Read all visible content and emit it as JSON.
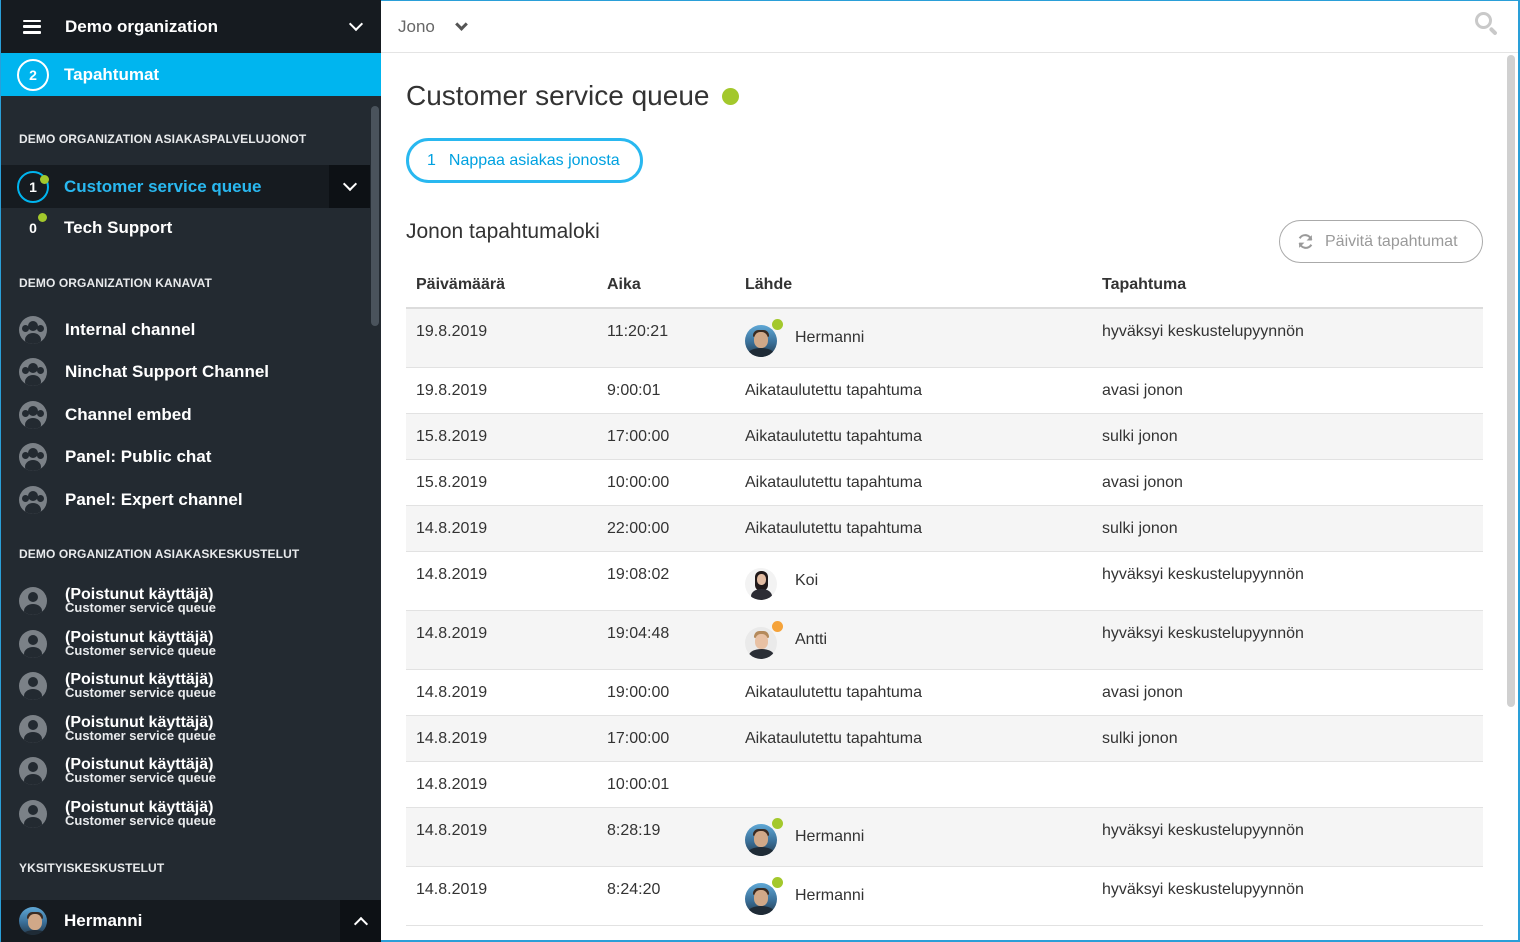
{
  "sidebar": {
    "org_name": "Demo organization",
    "events": {
      "count": "2",
      "label": "Tapahtumat"
    },
    "queues_heading": "DEMO ORGANIZATION ASIAKASPALVELUJONOT",
    "queues": [
      {
        "count": "1",
        "label": "Customer service queue",
        "active": true
      },
      {
        "count": "0",
        "label": "Tech Support",
        "active": false
      }
    ],
    "channels_heading": "DEMO ORGANIZATION KANAVAT",
    "channels": [
      {
        "label": "Internal channel"
      },
      {
        "label": "Ninchat Support Channel"
      },
      {
        "label": "Channel embed"
      },
      {
        "label": "Panel: Public chat"
      },
      {
        "label": "Panel: Expert channel"
      }
    ],
    "conversations_heading": "DEMO ORGANIZATION ASIAKASKESKUSTELUT",
    "conversations": [
      {
        "name": "(Poistunut käyttäjä)",
        "sub": "Customer service queue"
      },
      {
        "name": "(Poistunut käyttäjä)",
        "sub": "Customer service queue"
      },
      {
        "name": "(Poistunut käyttäjä)",
        "sub": "Customer service queue"
      },
      {
        "name": "(Poistunut käyttäjä)",
        "sub": "Customer service queue"
      },
      {
        "name": "(Poistunut käyttäjä)",
        "sub": "Customer service queue"
      },
      {
        "name": "(Poistunut käyttäjä)",
        "sub": "Customer service queue"
      }
    ],
    "private_heading": "YKSITYISKESKUSTELUT",
    "private_user": "Hermanni"
  },
  "topbar": {
    "breadcrumb": "Jono"
  },
  "main": {
    "title": "Customer service queue",
    "pick_button": {
      "count": "1",
      "label": "Nappaa asiakas jonosta"
    },
    "log_title": "Jonon tapahtumaloki",
    "refresh_label": "Päivitä tapahtumat",
    "columns": [
      "Päivämäärä",
      "Aika",
      "Lähde",
      "Tapahtuma"
    ],
    "rows": [
      {
        "date": "19.8.2019",
        "time": "11:20:21",
        "source": "Hermanni",
        "avatar": "herm",
        "status": "#a3c82c",
        "event": "hyväksyi keskustelupyynnön"
      },
      {
        "date": "19.8.2019",
        "time": "9:00:01",
        "source": "Aikataulutettu tapahtuma",
        "event": "avasi jonon"
      },
      {
        "date": "15.8.2019",
        "time": "17:00:00",
        "source": "Aikataulutettu tapahtuma",
        "event": "sulki jonon"
      },
      {
        "date": "15.8.2019",
        "time": "10:00:00",
        "source": "Aikataulutettu tapahtuma",
        "event": "avasi jonon"
      },
      {
        "date": "14.8.2019",
        "time": "22:00:00",
        "source": "Aikataulutettu tapahtuma",
        "event": "sulki jonon"
      },
      {
        "date": "14.8.2019",
        "time": "19:08:02",
        "source": "Koi",
        "avatar": "koi",
        "event": "hyväksyi keskustelupyynnön"
      },
      {
        "date": "14.8.2019",
        "time": "19:04:48",
        "source": "Antti",
        "avatar": "antti",
        "status": "#f5a33a",
        "event": "hyväksyi keskustelupyynnön"
      },
      {
        "date": "14.8.2019",
        "time": "19:00:00",
        "source": "Aikataulutettu tapahtuma",
        "event": "avasi jonon"
      },
      {
        "date": "14.8.2019",
        "time": "17:00:00",
        "source": "Aikataulutettu tapahtuma",
        "event": "sulki jonon"
      },
      {
        "date": "14.8.2019",
        "time": "10:00:01",
        "source": "",
        "event": ""
      },
      {
        "date": "14.8.2019",
        "time": "8:28:19",
        "source": "Hermanni",
        "avatar": "herm",
        "status": "#a3c82c",
        "event": "hyväksyi keskustelupyynnön"
      },
      {
        "date": "14.8.2019",
        "time": "8:24:20",
        "source": "Hermanni",
        "avatar": "herm",
        "status": "#a3c82c",
        "event": "hyväksyi keskustelupyynnön"
      }
    ]
  },
  "colors": {
    "accent": "#00b5ef",
    "online": "#a3c82c",
    "away": "#f5a33a",
    "sidebar_bg": "#232a31"
  }
}
